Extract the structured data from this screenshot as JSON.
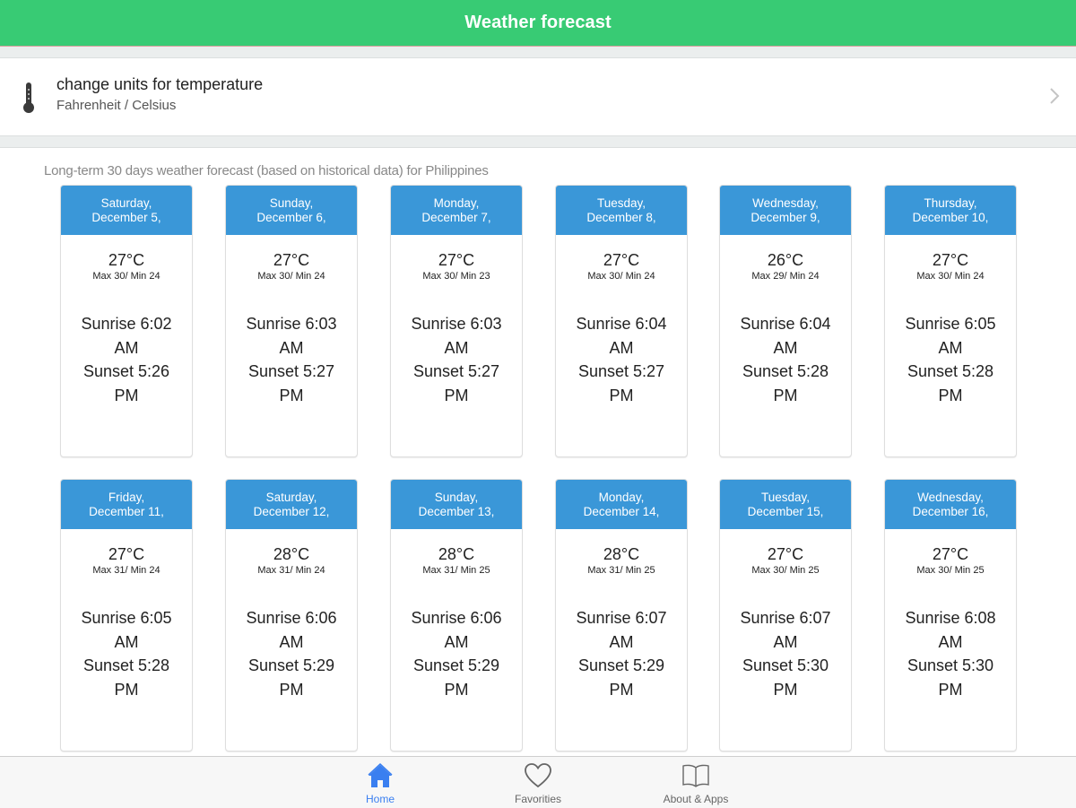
{
  "header": {
    "title": "Weather forecast"
  },
  "settings": {
    "icon": "thermometer-icon",
    "title": "change units for temperature",
    "subtitle": "Fahrenheit / Celsius",
    "chevron": "chevron-right-icon"
  },
  "subtitle": "Long-term 30 days weather forecast (based on historical data) for Philippines",
  "colors": {
    "header_green": "#38cb74",
    "card_header_blue": "#3a97d8",
    "tab_active_blue": "#3a7ff0"
  },
  "days": [
    {
      "weekday": "Saturday,",
      "date": "December 5,",
      "temp": "27°C",
      "maxmin": "Max 30/ Min 24",
      "sunrise": "Sunrise 6:02",
      "sunrise_ampm": "AM",
      "sunset": "Sunset 5:26",
      "sunset_ampm": "PM"
    },
    {
      "weekday": "Sunday,",
      "date": "December 6,",
      "temp": "27°C",
      "maxmin": "Max 30/ Min 24",
      "sunrise": "Sunrise 6:03",
      "sunrise_ampm": "AM",
      "sunset": "Sunset 5:27",
      "sunset_ampm": "PM"
    },
    {
      "weekday": "Monday,",
      "date": "December 7,",
      "temp": "27°C",
      "maxmin": "Max 30/ Min 23",
      "sunrise": "Sunrise 6:03",
      "sunrise_ampm": "AM",
      "sunset": "Sunset 5:27",
      "sunset_ampm": "PM"
    },
    {
      "weekday": "Tuesday,",
      "date": "December 8,",
      "temp": "27°C",
      "maxmin": "Max 30/ Min 24",
      "sunrise": "Sunrise 6:04",
      "sunrise_ampm": "AM",
      "sunset": "Sunset 5:27",
      "sunset_ampm": "PM"
    },
    {
      "weekday": "Wednesday,",
      "date": "December 9,",
      "temp": "26°C",
      "maxmin": "Max 29/ Min 24",
      "sunrise": "Sunrise 6:04",
      "sunrise_ampm": "AM",
      "sunset": "Sunset 5:28",
      "sunset_ampm": "PM"
    },
    {
      "weekday": "Thursday,",
      "date": "December 10,",
      "temp": "27°C",
      "maxmin": "Max 30/ Min 24",
      "sunrise": "Sunrise 6:05",
      "sunrise_ampm": "AM",
      "sunset": "Sunset 5:28",
      "sunset_ampm": "PM"
    },
    {
      "weekday": "Friday,",
      "date": "December 11,",
      "temp": "27°C",
      "maxmin": "Max 31/ Min 24",
      "sunrise": "Sunrise 6:05",
      "sunrise_ampm": "AM",
      "sunset": "Sunset 5:28",
      "sunset_ampm": "PM"
    },
    {
      "weekday": "Saturday,",
      "date": "December 12,",
      "temp": "28°C",
      "maxmin": "Max 31/ Min 24",
      "sunrise": "Sunrise 6:06",
      "sunrise_ampm": "AM",
      "sunset": "Sunset 5:29",
      "sunset_ampm": "PM"
    },
    {
      "weekday": "Sunday,",
      "date": "December 13,",
      "temp": "28°C",
      "maxmin": "Max 31/ Min 25",
      "sunrise": "Sunrise 6:06",
      "sunrise_ampm": "AM",
      "sunset": "Sunset 5:29",
      "sunset_ampm": "PM"
    },
    {
      "weekday": "Monday,",
      "date": "December 14,",
      "temp": "28°C",
      "maxmin": "Max 31/ Min 25",
      "sunrise": "Sunrise 6:07",
      "sunrise_ampm": "AM",
      "sunset": "Sunset 5:29",
      "sunset_ampm": "PM"
    },
    {
      "weekday": "Tuesday,",
      "date": "December 15,",
      "temp": "27°C",
      "maxmin": "Max 30/ Min 25",
      "sunrise": "Sunrise 6:07",
      "sunrise_ampm": "AM",
      "sunset": "Sunset 5:30",
      "sunset_ampm": "PM"
    },
    {
      "weekday": "Wednesday,",
      "date": "December 16,",
      "temp": "27°C",
      "maxmin": "Max 30/ Min 25",
      "sunrise": "Sunrise 6:08",
      "sunrise_ampm": "AM",
      "sunset": "Sunset 5:30",
      "sunset_ampm": "PM"
    }
  ],
  "tabbar": {
    "tabs": [
      {
        "label": "Home",
        "icon": "home-icon",
        "active": true
      },
      {
        "label": "Favorities",
        "icon": "heart-icon",
        "active": false
      },
      {
        "label": "About & Apps",
        "icon": "book-icon",
        "active": false
      }
    ]
  }
}
